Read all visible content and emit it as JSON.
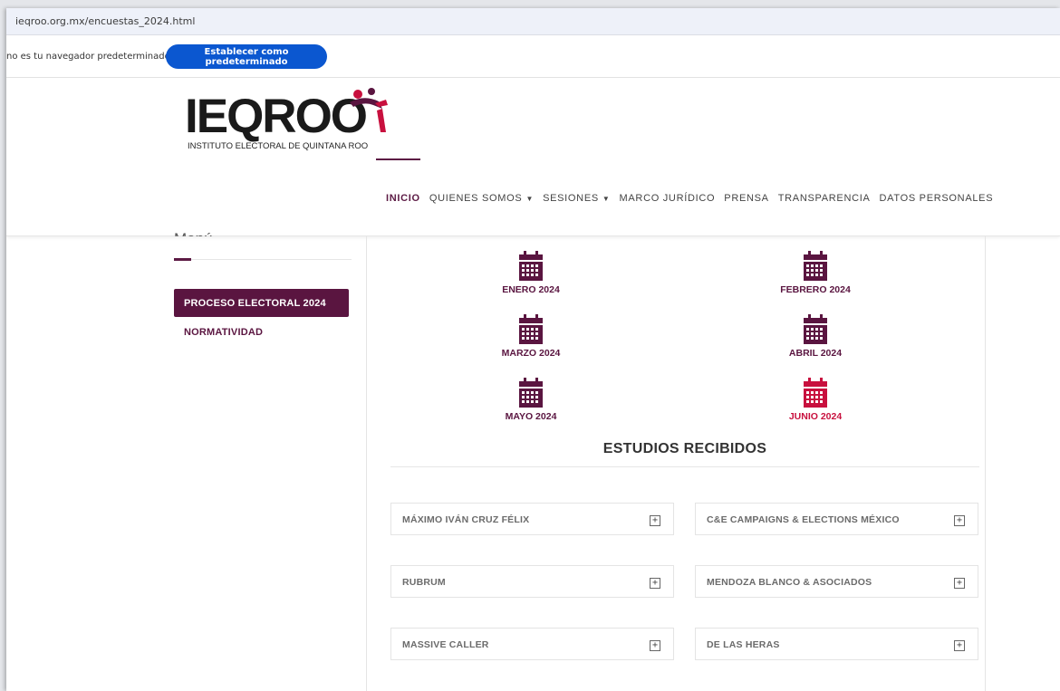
{
  "browser": {
    "url": "ieqroo.org.mx/encuestas_2024.html",
    "default_prompt": "no es tu navegador predeterminado",
    "default_button": "Establecer como predeterminado"
  },
  "logo": {
    "wordmark": "IEQROO",
    "subtitle": "INSTITUTO ELECTORAL DE QUINTANA ROO"
  },
  "nav": {
    "items": [
      {
        "label": "INICIO"
      },
      {
        "label": "QUIENES SOMOS"
      },
      {
        "label": "SESIONES"
      },
      {
        "label": "MARCO JURÍDICO"
      },
      {
        "label": "PRENSA"
      },
      {
        "label": "TRANSPARENCIA"
      },
      {
        "label": "DATOS PERSONALES"
      }
    ]
  },
  "sidebar": {
    "heading": "Menú",
    "items": [
      {
        "label": "PROCESO ELECTORAL 2024"
      },
      {
        "label": "NORMATIVIDAD"
      }
    ]
  },
  "months": [
    {
      "label": "ENERO 2024"
    },
    {
      "label": "FEBRERO 2024"
    },
    {
      "label": "MARZO 2024"
    },
    {
      "label": "ABRIL 2024"
    },
    {
      "label": "MAYO 2024"
    },
    {
      "label": "JUNIO 2024"
    }
  ],
  "studies": {
    "title": "ESTUDIOS RECIBIDOS",
    "items": [
      {
        "label": "MÁXIMO IVÁN CRUZ FÉLIX"
      },
      {
        "label": "C&E CAMPAIGNS & ELECTIONS MÉXICO"
      },
      {
        "label": "RUBRUM"
      },
      {
        "label": "MENDOZA BLANCO & ASOCIADOS"
      },
      {
        "label": "MASSIVE CALLER"
      },
      {
        "label": "DE LAS HERAS"
      }
    ],
    "toggle_symbol": "+"
  },
  "colors": {
    "brand": "#5a1540",
    "current_month": "#c8103e",
    "browser_button": "#0b57d0"
  },
  "icons": {
    "month": "calendar-icon",
    "expand": "plus-square-icon"
  }
}
